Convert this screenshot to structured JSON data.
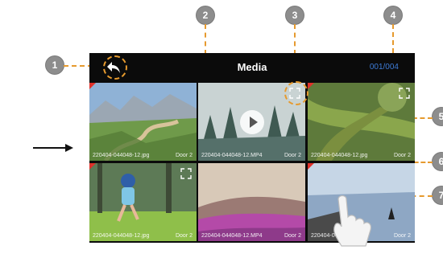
{
  "header": {
    "title": "Media",
    "counter": "001/004"
  },
  "tiles": [
    {
      "caption": "220404-044048-12.jpg",
      "door": "Door 2",
      "type": "image"
    },
    {
      "caption": "220404-044048-12.MP4",
      "door": "Door 2",
      "type": "video"
    },
    {
      "caption": "220404-044048-12.jpg",
      "door": "Door 2",
      "type": "image"
    },
    {
      "caption": "220404-044048-12.jpg",
      "door": "Door 2",
      "type": "image"
    },
    {
      "caption": "220404-044048-12.MP4",
      "door": "Door 2",
      "type": "video"
    },
    {
      "caption": "220404-044048",
      "door": "Door 2",
      "type": "image"
    }
  ],
  "callouts": [
    "1",
    "2",
    "3",
    "4",
    "5",
    "6",
    "7"
  ],
  "colors": {
    "accent_dash": "#e69a2e",
    "counter_blue": "#3d7bd6",
    "corner_red": "#e0312a",
    "screen_bg": "#0b0b0b"
  },
  "icons": {
    "back": "back-arrow-icon",
    "play": "play-icon",
    "select": "select-frame-icon",
    "pointer": "arrow-right-icon",
    "hand": "hand-pointer-icon"
  }
}
